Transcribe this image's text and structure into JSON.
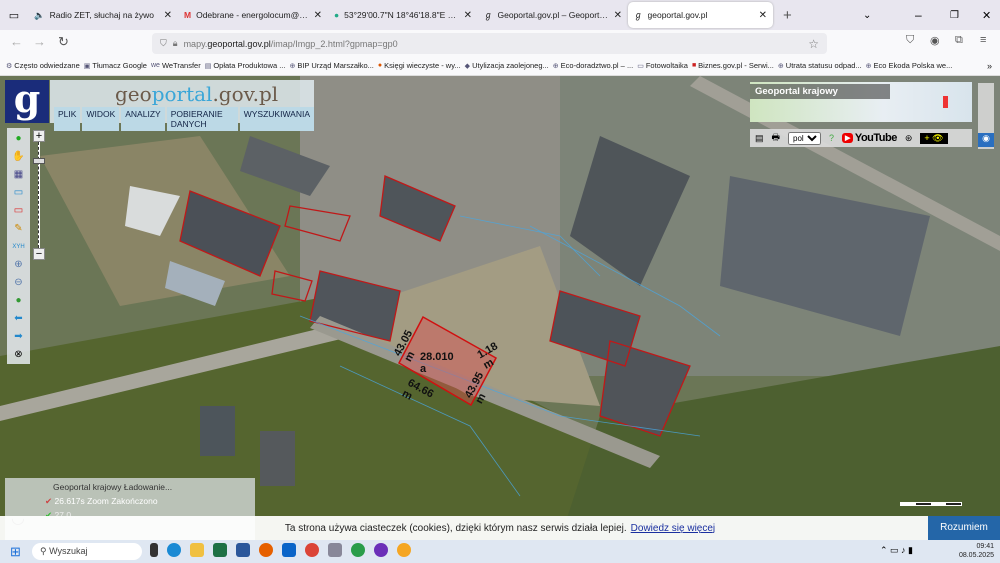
{
  "browser": {
    "tabs": [
      {
        "title": "Radio ZET, słuchaj na żywo",
        "icon": "speaker-icon"
      },
      {
        "title": "Odebrane - energolocum@gmail.com -",
        "icon": "gmail-icon"
      },
      {
        "title": "53°29'00.7\"N 18°46'18.8\"E – Mapy Goog",
        "icon": "maps-pin-icon"
      },
      {
        "title": "Geoportal.gov.pl – Geoportal Infrastrukt",
        "icon": "geoportal-icon"
      },
      {
        "title": "geoportal.gov.pl",
        "icon": "geoportal-icon",
        "active": true
      }
    ],
    "url_prefix": "mapy.",
    "url_domain": "geoportal.gov.pl",
    "url_path": "/imap/Imgp_2.html?gpmap=gp0",
    "bookmarks": [
      "Często odwiedzane",
      "Tłumacz Google",
      "WeTransfer",
      "Opłata Produktowa ...",
      "BIP Urząd Marszałko...",
      "Księgi wieczyste - wy...",
      "Utylizacja zaolejoneg...",
      "Eco-doradztwo.pl – ...",
      "Fotowoltaika",
      "Biznes.gov.pl - Serwi...",
      "Utrata statusu odpad...",
      "Eco Ekoda Polska we..."
    ]
  },
  "geoportal": {
    "logo_letter": "g",
    "name_a": "geo",
    "name_b": "portal",
    "name_c": ".gov.pl",
    "menu": [
      "PLIK",
      "WIDOK",
      "ANALIZY",
      "POBIERANIE DANYCH",
      "WYSZUKIWANIA"
    ],
    "overview_label": "Geoportal krajowy",
    "language": "pol",
    "youtube": "YouTube",
    "parcel": {
      "area": "28.010 a",
      "edges": [
        "43.05 m",
        "1.18 m",
        "43.95 m",
        "64.66 m"
      ]
    },
    "status_rows": [
      {
        "text": "Geoportal krajowy  Ładowanie..."
      },
      {
        "time": "26.617s",
        "action": "Zoom",
        "state": "Zakończono"
      },
      {
        "time": "27.0..."
      }
    ]
  },
  "cookie": {
    "text": "Ta strona używa ciasteczek (cookies), dzięki którym nasz serwis działa lepiej.",
    "link": "Dowiedz się więcej",
    "button": "Rozumiem"
  },
  "taskbar": {
    "search": "Wyszukaj",
    "time": "09:41",
    "date": "08.05.2025"
  }
}
